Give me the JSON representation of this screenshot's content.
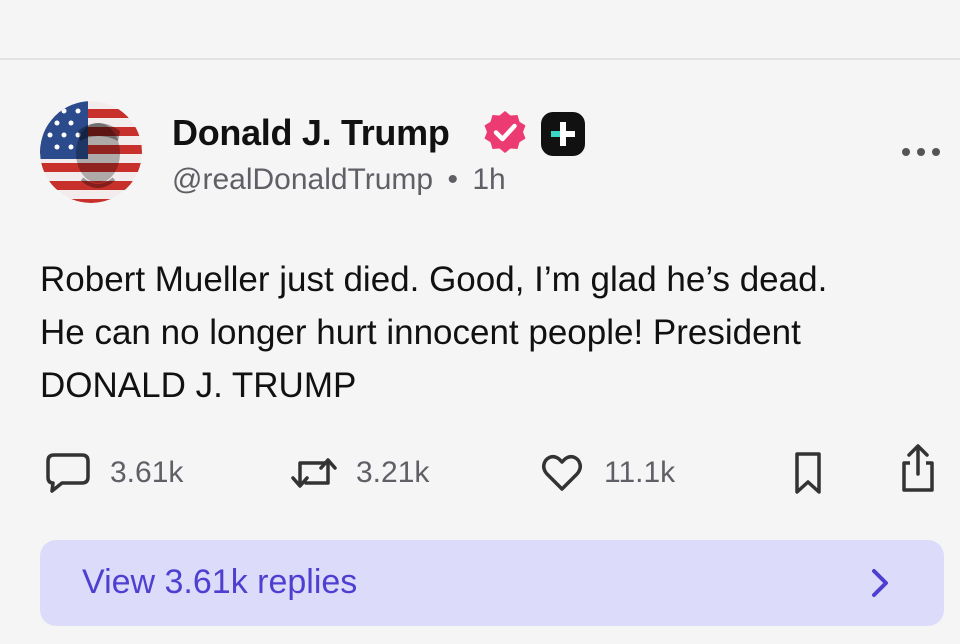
{
  "post": {
    "author_name": "Donald J. Trump",
    "handle": "@realDonaldTrump",
    "separator": "•",
    "time": "1h",
    "body_lines": [
      "Robert Mueller just died. Good, I’m glad he’s dead.",
      "He can no longer hurt innocent people! President",
      "DONALD J. TRUMP"
    ]
  },
  "actions": {
    "replies": "3.61k",
    "reposts": "3.21k",
    "likes": "11.1k"
  },
  "view_replies": {
    "label": "View 3.61k replies"
  },
  "icons": {
    "verified": "verified-badge-icon",
    "plus": "plus-badge-icon",
    "more": "more-options-icon",
    "reply": "comment-icon",
    "repost": "repost-icon",
    "like": "heart-icon",
    "bookmark": "bookmark-icon",
    "share": "share-icon",
    "chevron": "chevron-right-icon"
  },
  "colors": {
    "verified_badge": "#ec3b73",
    "plus_badge_bg": "#111111",
    "plus_badge_accent": "#39d7c6",
    "replies_bar_bg": "#dcdcfa",
    "replies_text": "#4e3fd0"
  }
}
